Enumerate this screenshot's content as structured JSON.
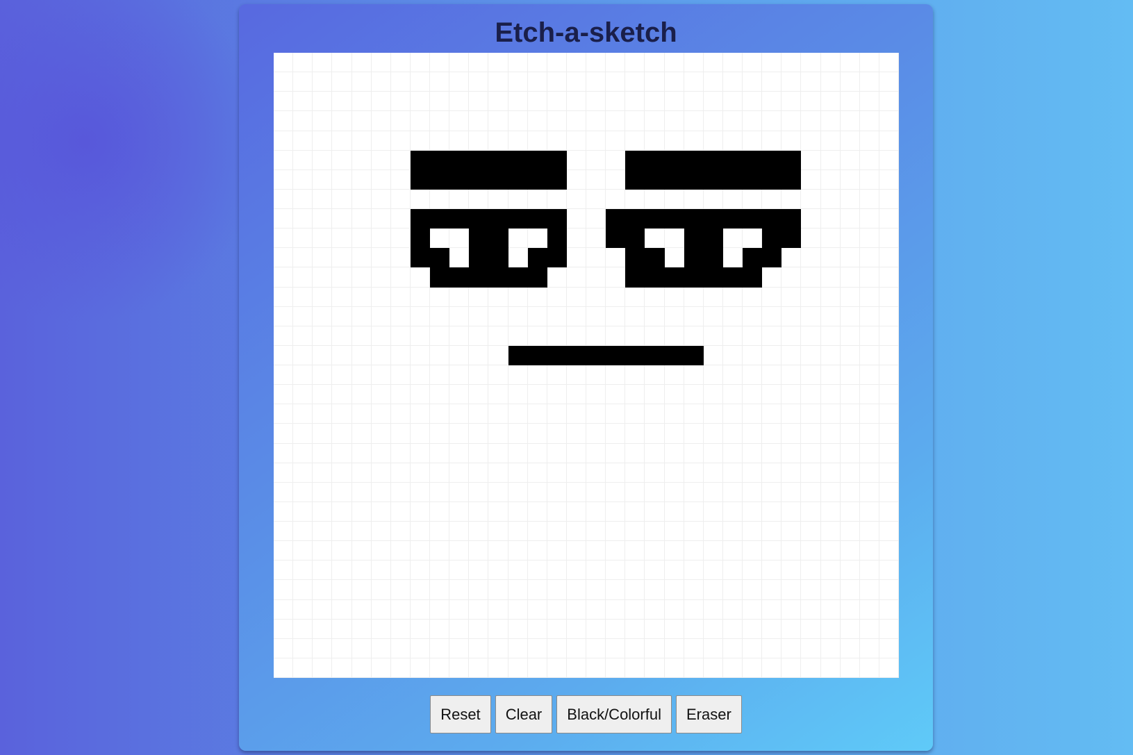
{
  "app": {
    "title": "Etch-a-sketch"
  },
  "grid": {
    "size": 32,
    "cell_color": "#ffffff",
    "line_color": "#eeeeee",
    "ink_color": "#000000",
    "filled": [
      [
        5,
        7
      ],
      [
        5,
        8
      ],
      [
        5,
        9
      ],
      [
        5,
        10
      ],
      [
        5,
        11
      ],
      [
        5,
        12
      ],
      [
        5,
        13
      ],
      [
        5,
        14
      ],
      [
        5,
        18
      ],
      [
        5,
        19
      ],
      [
        5,
        20
      ],
      [
        5,
        21
      ],
      [
        5,
        22
      ],
      [
        5,
        23
      ],
      [
        5,
        24
      ],
      [
        5,
        25
      ],
      [
        5,
        26
      ],
      [
        6,
        7
      ],
      [
        6,
        8
      ],
      [
        6,
        9
      ],
      [
        6,
        10
      ],
      [
        6,
        11
      ],
      [
        6,
        12
      ],
      [
        6,
        13
      ],
      [
        6,
        14
      ],
      [
        6,
        18
      ],
      [
        6,
        19
      ],
      [
        6,
        20
      ],
      [
        6,
        21
      ],
      [
        6,
        22
      ],
      [
        6,
        23
      ],
      [
        6,
        24
      ],
      [
        6,
        25
      ],
      [
        6,
        26
      ],
      [
        8,
        7
      ],
      [
        8,
        8
      ],
      [
        8,
        9
      ],
      [
        8,
        10
      ],
      [
        8,
        11
      ],
      [
        8,
        12
      ],
      [
        8,
        13
      ],
      [
        8,
        14
      ],
      [
        8,
        17
      ],
      [
        8,
        18
      ],
      [
        8,
        19
      ],
      [
        8,
        20
      ],
      [
        8,
        21
      ],
      [
        8,
        22
      ],
      [
        8,
        23
      ],
      [
        8,
        24
      ],
      [
        8,
        25
      ],
      [
        8,
        26
      ],
      [
        9,
        7
      ],
      [
        9,
        10
      ],
      [
        9,
        11
      ],
      [
        9,
        14
      ],
      [
        9,
        17
      ],
      [
        9,
        18
      ],
      [
        9,
        21
      ],
      [
        9,
        22
      ],
      [
        9,
        25
      ],
      [
        9,
        26
      ],
      [
        10,
        7
      ],
      [
        10,
        8
      ],
      [
        10,
        10
      ],
      [
        10,
        11
      ],
      [
        10,
        13
      ],
      [
        10,
        14
      ],
      [
        10,
        18
      ],
      [
        10,
        19
      ],
      [
        10,
        21
      ],
      [
        10,
        22
      ],
      [
        10,
        24
      ],
      [
        10,
        25
      ],
      [
        11,
        8
      ],
      [
        11,
        9
      ],
      [
        11,
        10
      ],
      [
        11,
        11
      ],
      [
        11,
        12
      ],
      [
        11,
        13
      ],
      [
        11,
        18
      ],
      [
        11,
        19
      ],
      [
        11,
        20
      ],
      [
        11,
        21
      ],
      [
        11,
        22
      ],
      [
        11,
        23
      ],
      [
        11,
        24
      ],
      [
        15,
        12
      ],
      [
        15,
        13
      ],
      [
        15,
        14
      ],
      [
        15,
        15
      ],
      [
        15,
        16
      ],
      [
        15,
        17
      ],
      [
        15,
        18
      ],
      [
        15,
        19
      ],
      [
        15,
        20
      ],
      [
        15,
        21
      ]
    ]
  },
  "controls": {
    "reset_label": "Reset",
    "clear_label": "Clear",
    "mode_label": "Black/Colorful",
    "eraser_label": "Eraser"
  }
}
